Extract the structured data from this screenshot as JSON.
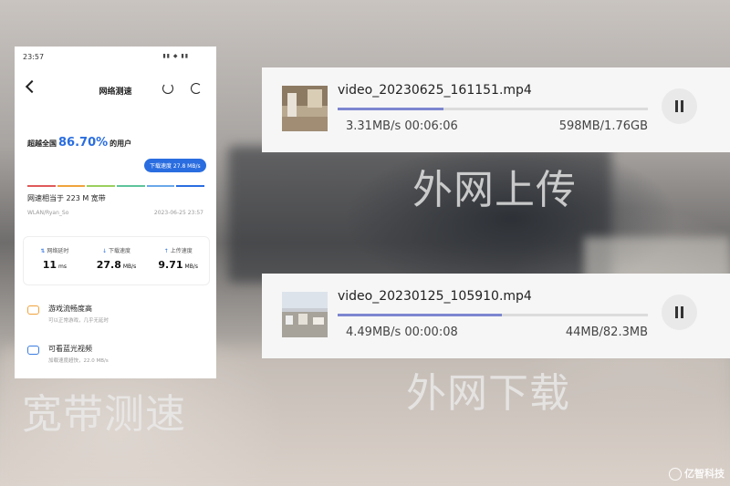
{
  "phone": {
    "status_time": "23:57",
    "status_icons": "▮▮ ◆ ▮▮",
    "title": "网络测速",
    "beat_prefix": "超越全国",
    "beat_pct": "86.70%",
    "beat_suffix": "的用户",
    "bubble": "下载速度 27.8 MB/s",
    "scale_colors": [
      "#e05a5a",
      "#f0a33c",
      "#9bcf5f",
      "#5ec49a",
      "#6aa7e8",
      "#2a6de0"
    ],
    "speed_line": "网速相当于 223 M 宽带",
    "network": "WLAN/Ryan_So",
    "datetime": "2023-06-25 23:57",
    "metrics": [
      {
        "icon": "⇅",
        "label": "网络延时",
        "value": "11",
        "unit": "ms"
      },
      {
        "icon": "↓",
        "label": "下载速度",
        "value": "27.8",
        "unit": "MB/s"
      },
      {
        "icon": "↑",
        "label": "上传速度",
        "value": "9.71",
        "unit": "MB/s"
      }
    ],
    "features": [
      {
        "title": "游戏流畅度高",
        "sub": "可以正常游戏，几乎无延时",
        "color": "#f0a33c"
      },
      {
        "title": "可看蓝光视频",
        "sub": "加载速度超快，22.0 MB/s",
        "color": "#3b7de0"
      }
    ]
  },
  "transfers": [
    {
      "file": "video_20230625_161151.mp4",
      "rate": "3.31MB/s 00:06:06",
      "size": "598MB/1.76GB",
      "progress": 0.34
    },
    {
      "file": "video_20230125_105910.mp4",
      "rate": "4.49MB/s 00:00:08",
      "size": "44MB/82.3MB",
      "progress": 0.53
    }
  ],
  "captions": {
    "upload": "外网上传",
    "download": "外网下载",
    "speedtest": "宽带测速"
  },
  "watermark": "亿智科技"
}
